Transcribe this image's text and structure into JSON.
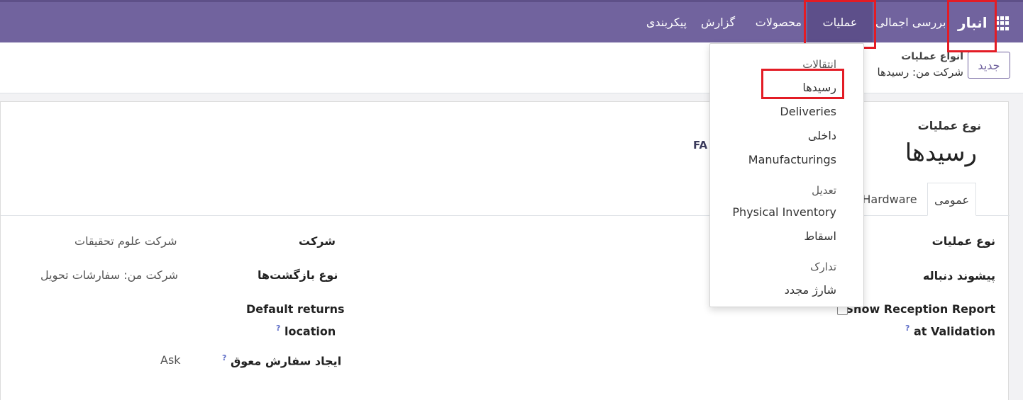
{
  "navbar": {
    "brand": "انبار",
    "menu": [
      "بررسی اجمالی",
      "عملیات",
      "محصولات",
      "گزارش",
      "پیکربندی"
    ]
  },
  "control": {
    "new_button": "جدید",
    "breadcrumb_parent": "انواع عملیات",
    "breadcrumb_current": "شرکت من: رسیدها"
  },
  "dropdown": {
    "sections": [
      {
        "header": "انتقالات",
        "items": [
          "رسیدها",
          "Deliveries",
          "داخلی",
          "Manufacturings"
        ]
      },
      {
        "header": "تعدیل",
        "items": [
          "Physical Inventory",
          "اسقاط"
        ]
      },
      {
        "header": "تدارک",
        "items": [
          "شارژ مجدد"
        ]
      }
    ]
  },
  "form": {
    "label_small": "نوع عملیات",
    "title": "رسیدها",
    "fa_text": "FA",
    "tabs": [
      "عمومی",
      "Hardware"
    ],
    "left_fields": [
      {
        "label": "نوع عملیات"
      },
      {
        "label": "پیشوند دنباله"
      },
      {
        "label_line1": "Show Reception Report",
        "label_line2": "at Validation",
        "tip": "?"
      }
    ],
    "right_fields": [
      {
        "label": "شرکت",
        "value": "شرکت علوم تحقیقات"
      },
      {
        "label": "نوع بازگشت‌ها",
        "value": "شرکت من: سفارشات تحویل"
      },
      {
        "label_line1": "Default returns",
        "label_line2": "location",
        "tip": "?"
      },
      {
        "label": "ایجاد سفارش معوق",
        "value": "Ask",
        "tip": "?"
      }
    ]
  },
  "colors": {
    "navbar": "#71639e",
    "highlight": "#e31c25",
    "accent": "#71639e"
  }
}
